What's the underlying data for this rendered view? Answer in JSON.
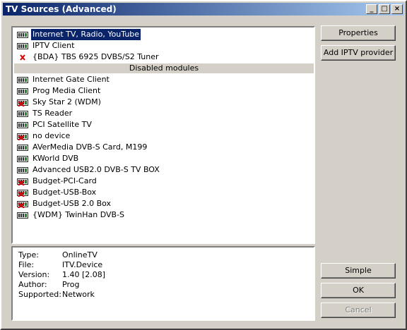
{
  "window": {
    "title": "TV Sources (Advanced)"
  },
  "list": {
    "active": [
      {
        "label": "Internet TV, Radio, YouTube",
        "icon": "tuner-icon",
        "selected": true
      },
      {
        "label": "IPTV Client",
        "icon": "tuner-icon"
      },
      {
        "label": "{BDA} TBS 6925 DVBS/S2 Tuner",
        "icon": "red-x-icon"
      }
    ],
    "separator": "Disabled modules",
    "disabled": [
      {
        "label": "Internet Gate Client",
        "icon": "tuner-icon"
      },
      {
        "label": "Prog Media Client",
        "icon": "tuner-icon"
      },
      {
        "label": "Sky Star 2 (WDM)",
        "icon": "tuner-error-icon"
      },
      {
        "label": "TS Reader",
        "icon": "tuner-icon"
      },
      {
        "label": "PCI Satellite TV",
        "icon": "tuner-icon"
      },
      {
        "label": "no device",
        "icon": "tuner-error-icon"
      },
      {
        "label": "AVerMedia DVB-S Card, M199",
        "icon": "tuner-icon"
      },
      {
        "label": "KWorld DVB",
        "icon": "tuner-icon"
      },
      {
        "label": "Advanced USB2.0 DVB-S TV BOX",
        "icon": "tuner-icon"
      },
      {
        "label": "Budget-PCI-Card",
        "icon": "tuner-error-icon"
      },
      {
        "label": "Budget-USB-Box",
        "icon": "tuner-error-icon"
      },
      {
        "label": "Budget-USB 2.0 Box",
        "icon": "tuner-error-icon"
      },
      {
        "label": "{WDM} TwinHan DVB-S",
        "icon": "tuner-icon"
      }
    ]
  },
  "info": [
    {
      "key": "Type:",
      "value": "OnlineTV"
    },
    {
      "key": "File:",
      "value": "ITV.Device"
    },
    {
      "key": "Version:",
      "value": "1.40 [2.08]"
    },
    {
      "key": "Author:",
      "value": "Prog"
    },
    {
      "key": "Supported:",
      "value": "Network"
    }
  ],
  "buttons": {
    "properties": "Properties",
    "add_iptv": "Add IPTV provider",
    "simple": "Simple",
    "ok": "OK",
    "cancel": "Cancel"
  },
  "colors": {
    "selection": "#0a246a",
    "error": "#d40000",
    "tuner_green": "#1c8a2a"
  }
}
